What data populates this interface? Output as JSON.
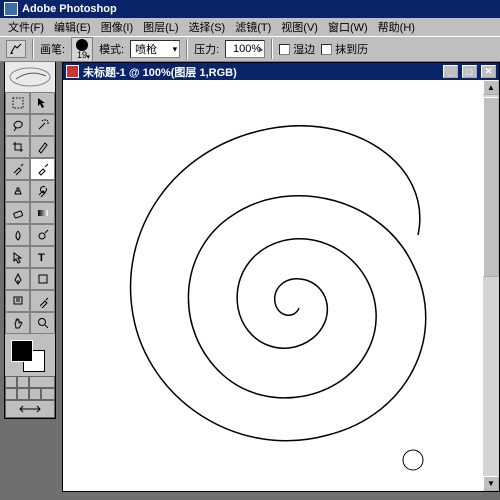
{
  "app": {
    "title": "Adobe Photoshop"
  },
  "menu": {
    "file": "文件(F)",
    "edit": "编辑(E)",
    "image": "图像(I)",
    "layer": "图层(L)",
    "select": "选择(S)",
    "filter": "滤镜(T)",
    "view": "视图(V)",
    "window": "窗口(W)",
    "help": "帮助(H)"
  },
  "opt": {
    "brush_label": "画笔:",
    "brush_size": "19",
    "mode_label": "模式:",
    "mode_value": "喷枪",
    "pressure_label": "压力:",
    "pressure_value": "100%",
    "wet_label": "湿边",
    "erase_label": "抹到历"
  },
  "doc": {
    "title": "未标题-1 @ 100%(图层 1,RGB)"
  },
  "tools": {
    "names": [
      [
        "rect-marquee",
        "move"
      ],
      [
        "lasso",
        "magic-wand"
      ],
      [
        "crop",
        "slice"
      ],
      [
        "airbrush",
        "brush"
      ],
      [
        "clone",
        "history-brush"
      ],
      [
        "eraser",
        "paint-bucket"
      ],
      [
        "blur",
        "dodge"
      ],
      [
        "path-select",
        "type"
      ],
      [
        "pen",
        "shape"
      ],
      [
        "notes",
        "eyedropper"
      ],
      [
        "hand",
        "zoom"
      ]
    ]
  },
  "ui": {
    "min_glyph": "_",
    "max_glyph": "□",
    "close_glyph": "✕",
    "up": "▲",
    "down": "▼"
  }
}
